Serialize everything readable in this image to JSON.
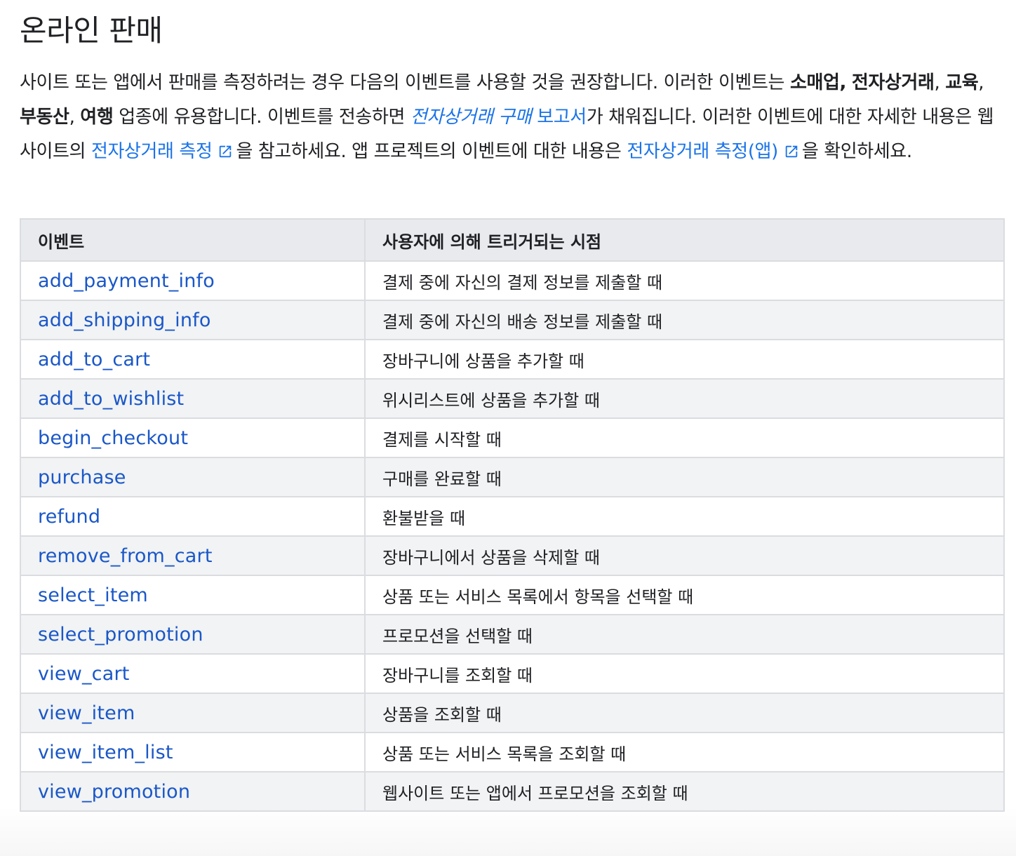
{
  "page_title": "온라인 판매",
  "intro": {
    "t1": "사이트 또는 앱에서 판매를 측정하려는 경우 다음의 이벤트를 사용할 것을 권장합니다. 이러한 이벤트는 ",
    "b1": "소매업,",
    "t2": " ",
    "b2": "전자상거래",
    "t3": ", ",
    "b3": "교육",
    "t4": ", ",
    "b4": "부동산",
    "t5": ", ",
    "b5": "여행",
    "t6": " 업종에 유용합니다. 이벤트를 전송하면 ",
    "link1": "전자상거래 구매",
    "link2": " 보고서",
    "t7": "가 채워집니다. 이러한 이벤트에 대한 자세한 내용은 웹사이트의 ",
    "link3": "전자상거래 측정",
    "t8": "을 참고하세요. 앱 프로젝트의 이벤트에 대한 내용은 ",
    "link4": "전자상거래 측정(앱)",
    "t9": "을 확인하세요."
  },
  "table": {
    "headers": [
      "이벤트",
      "사용자에 의해 트리거되는 시점"
    ],
    "rows": [
      {
        "event": "add_payment_info",
        "trigger": "결제 중에 자신의 결제 정보를 제출할 때"
      },
      {
        "event": "add_shipping_info",
        "trigger": "결제 중에 자신의 배송 정보를 제출할 때"
      },
      {
        "event": "add_to_cart",
        "trigger": "장바구니에 상품을 추가할 때"
      },
      {
        "event": "add_to_wishlist",
        "trigger": "위시리스트에 상품을 추가할 때"
      },
      {
        "event": "begin_checkout",
        "trigger": "결제를 시작할 때"
      },
      {
        "event": "purchase",
        "trigger": "구매를 완료할 때"
      },
      {
        "event": "refund",
        "trigger": "환불받을 때"
      },
      {
        "event": "remove_from_cart",
        "trigger": "장바구니에서 상품을 삭제할 때"
      },
      {
        "event": "select_item",
        "trigger": "상품 또는 서비스 목록에서 항목을 선택할 때"
      },
      {
        "event": "select_promotion",
        "trigger": "프로모션을 선택할 때"
      },
      {
        "event": "view_cart",
        "trigger": "장바구니를 조회할 때"
      },
      {
        "event": "view_item",
        "trigger": "상품을 조회할 때"
      },
      {
        "event": "view_item_list",
        "trigger": "상품 또는 서비스 목록을 조회할 때"
      },
      {
        "event": "view_promotion",
        "trigger": "웹사이트 또는 앱에서 프로모션을 조회할 때"
      }
    ]
  },
  "colors": {
    "link": "#1a73e8",
    "event_link": "#1a57c8",
    "text": "#202124",
    "header_bg": "#e8eaed",
    "row_alt_bg": "#f1f3f4",
    "border": "#dadce0"
  },
  "icons": {
    "external_link": "open-in-new-icon"
  }
}
